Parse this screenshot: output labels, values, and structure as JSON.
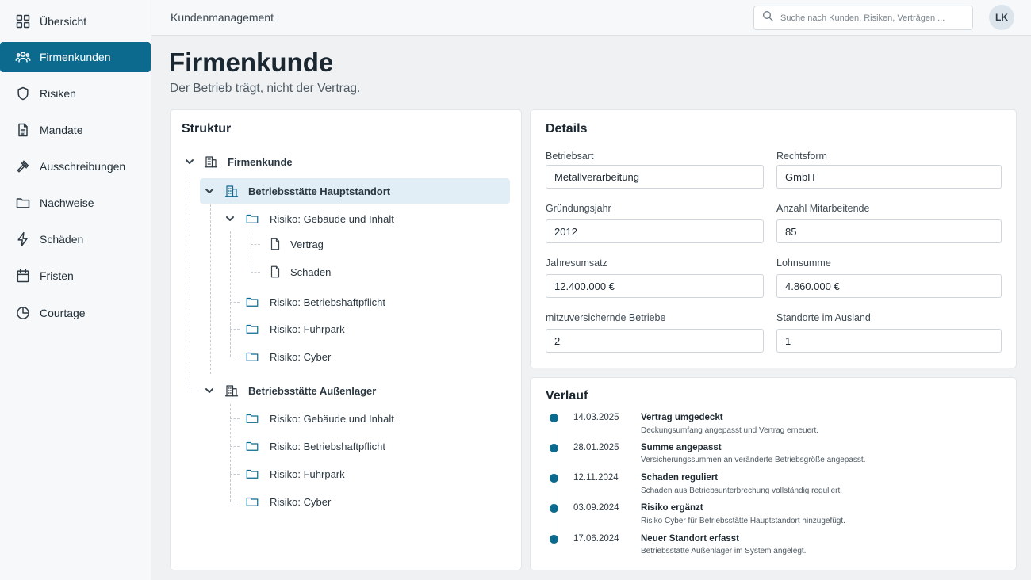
{
  "sidebar": {
    "items": [
      {
        "label": "Übersicht",
        "icon": "grid-icon"
      },
      {
        "label": "Firmenkunden",
        "icon": "users-icon",
        "active": true
      },
      {
        "label": "Risiken",
        "icon": "shield-icon"
      },
      {
        "label": "Mandate",
        "icon": "document-icon"
      },
      {
        "label": "Ausschreibungen",
        "icon": "gavel-icon"
      },
      {
        "label": "Nachweise",
        "icon": "folder-icon"
      },
      {
        "label": "Schäden",
        "icon": "lightning-icon"
      },
      {
        "label": "Fristen",
        "icon": "calendar-icon"
      },
      {
        "label": "Courtage",
        "icon": "pie-chart-icon"
      }
    ]
  },
  "topbar": {
    "title": "Kundenmanagement",
    "search_placeholder": "Suche nach Kunden, Risiken, Verträgen ...",
    "avatar_initials": "LK"
  },
  "header": {
    "title": "Firmenkunde",
    "subtitle": "Der Betrieb trägt, nicht der Vertrag."
  },
  "structure": {
    "title": "Struktur",
    "root": "Firmenkunde",
    "site1": {
      "label": "Betriebsstätte Hauptstandort",
      "risk1": "Risiko: Gebäude und Inhalt",
      "doc1": "Vertrag",
      "doc2": "Schaden",
      "risk2": "Risiko: Betriebshaftpflicht",
      "risk3": "Risiko: Fuhrpark",
      "risk4": "Risiko: Cyber"
    },
    "site2": {
      "label": "Betriebsstätte Außenlager",
      "risk1": "Risiko: Gebäude und Inhalt",
      "risk2": "Risiko: Betriebshaftpflicht",
      "risk3": "Risiko: Fuhrpark",
      "risk4": "Risiko: Cyber"
    }
  },
  "details": {
    "title": "Details",
    "fields": {
      "betriebsart": {
        "label": "Betriebsart",
        "value": "Metallverarbeitung"
      },
      "rechtsform": {
        "label": "Rechtsform",
        "value": "GmbH"
      },
      "gruendungsjahr": {
        "label": "Gründungsjahr",
        "value": "2012"
      },
      "mitarbeitende": {
        "label": "Anzahl Mitarbeitende",
        "value": "85"
      },
      "jahresumsatz": {
        "label": "Jahresumsatz",
        "value": "12.400.000 €"
      },
      "lohnsumme": {
        "label": "Lohnsumme",
        "value": "4.860.000 €"
      },
      "betriebe": {
        "label": "mitzuversichernde Betriebe",
        "value": "2"
      },
      "ausland": {
        "label": "Standorte im Ausland",
        "value": "1"
      }
    }
  },
  "history": {
    "title": "Verlauf",
    "entries": [
      {
        "date": "14.03.2025",
        "title": "Vertrag umgedeckt",
        "desc": "Deckungsumfang angepasst und Vertrag erneuert."
      },
      {
        "date": "28.01.2025",
        "title": "Summe angepasst",
        "desc": "Versicherungssummen an veränderte Betriebsgröße angepasst."
      },
      {
        "date": "12.11.2024",
        "title": "Schaden reguliert",
        "desc": "Schaden aus Betriebsunterbrechung vollständig reguliert."
      },
      {
        "date": "03.09.2024",
        "title": "Risiko ergänzt",
        "desc": "Risiko Cyber für Betriebsstätte Hauptstandort hinzugefügt."
      },
      {
        "date": "17.06.2024",
        "title": "Neuer Standort erfasst",
        "desc": "Betriebsstätte Außenlager im System angelegt."
      }
    ]
  },
  "colors": {
    "accent": "#0d6a8f",
    "selected_row": "#e1eef6",
    "background": "#eff1f3"
  }
}
